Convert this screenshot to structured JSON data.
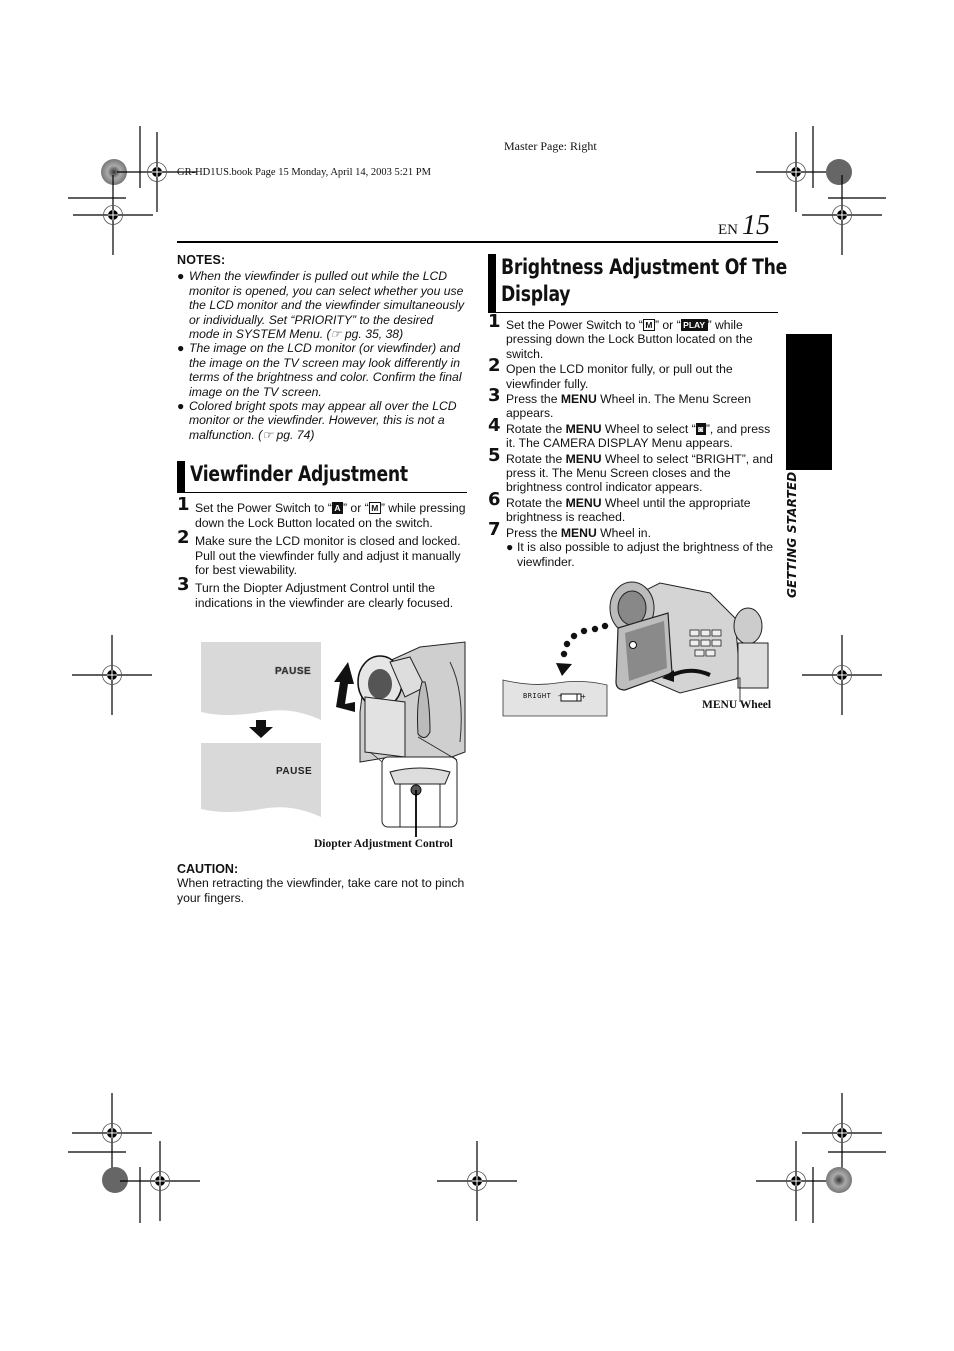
{
  "header": {
    "master_page": "Master Page: Right",
    "book_info": "GR-HD1US.book  Page 15  Monday, April 14, 2003  5:21 PM",
    "language": "EN",
    "page_number": "15"
  },
  "side_tab": {
    "label": "GETTING STARTED"
  },
  "notes": {
    "title": "NOTES:",
    "items": [
      "When the viewfinder is pulled out while the LCD monitor is opened, you can select whether you use the LCD monitor and the viewfinder simultaneously or individually. Set “PRIORITY” to the desired mode in SYSTEM Menu. (☞ pg. 35, 38)",
      "The image on the LCD monitor (or viewfinder) and the image on the TV screen may look differently in terms of the brightness and color. Confirm the final image on the TV screen.",
      "Colored bright spots may appear all over the LCD monitor or the viewfinder. However, this is not a malfunction. (☞ pg. 74)"
    ],
    "bullet": "●"
  },
  "viewfinder": {
    "title": "Viewfinder Adjustment",
    "steps": [
      {
        "num": "1",
        "pre": "Set the Power Switch to “",
        "icon1": "A",
        "mid": "” or “",
        "icon2": "M",
        "post": "” while pressing down the Lock Button located on the switch."
      },
      {
        "num": "2",
        "text": "Make sure the LCD monitor is closed and locked. Pull out the viewfinder fully and adjust it manually for best viewability."
      },
      {
        "num": "3",
        "text": "Turn the Diopter Adjustment Control until the indications in the viewfinder are clearly focused."
      }
    ],
    "figure": {
      "screen_before": "PAUSE",
      "screen_after": "PAUSE",
      "caption": "Diopter Adjustment Control"
    }
  },
  "caution": {
    "title": "CAUTION:",
    "text": "When retracting the viewfinder, take care not to pinch your fingers."
  },
  "brightness": {
    "title_line1": "Brightness Adjustment Of The",
    "title_line2": "Display",
    "menu_word": "MENU",
    "steps": [
      {
        "num": "1",
        "pre": "Set the Power Switch to “",
        "icon1": "M",
        "mid": "” or “",
        "icon2": "PLAY",
        "post": "” while pressing down the Lock Button located on the switch."
      },
      {
        "num": "2",
        "text": "Open the LCD monitor fully, or pull out the viewfinder fully."
      },
      {
        "num": "3",
        "pre": "Press the ",
        "post": " Wheel in. The Menu Screen appears."
      },
      {
        "num": "4",
        "pre": "Rotate the ",
        "mid": " Wheel to select “",
        "icon": "◙",
        "post": "”, and press it. The CAMERA DISPLAY Menu appears."
      },
      {
        "num": "5",
        "pre": "Rotate the ",
        "post": " Wheel to select “BRIGHT”, and press it. The Menu Screen closes and the brightness control indicator appears."
      },
      {
        "num": "6",
        "pre": "Rotate the ",
        "post": " Wheel until the appropriate brightness is reached."
      },
      {
        "num": "7",
        "pre": "Press the ",
        "post": " Wheel in."
      }
    ],
    "sub_note": "It is also possible to adjust the brightness of the viewfinder.",
    "figure": {
      "indicator_label": "BRIGHT",
      "minus": "−",
      "plus": "+",
      "caption": "MENU Wheel"
    }
  }
}
